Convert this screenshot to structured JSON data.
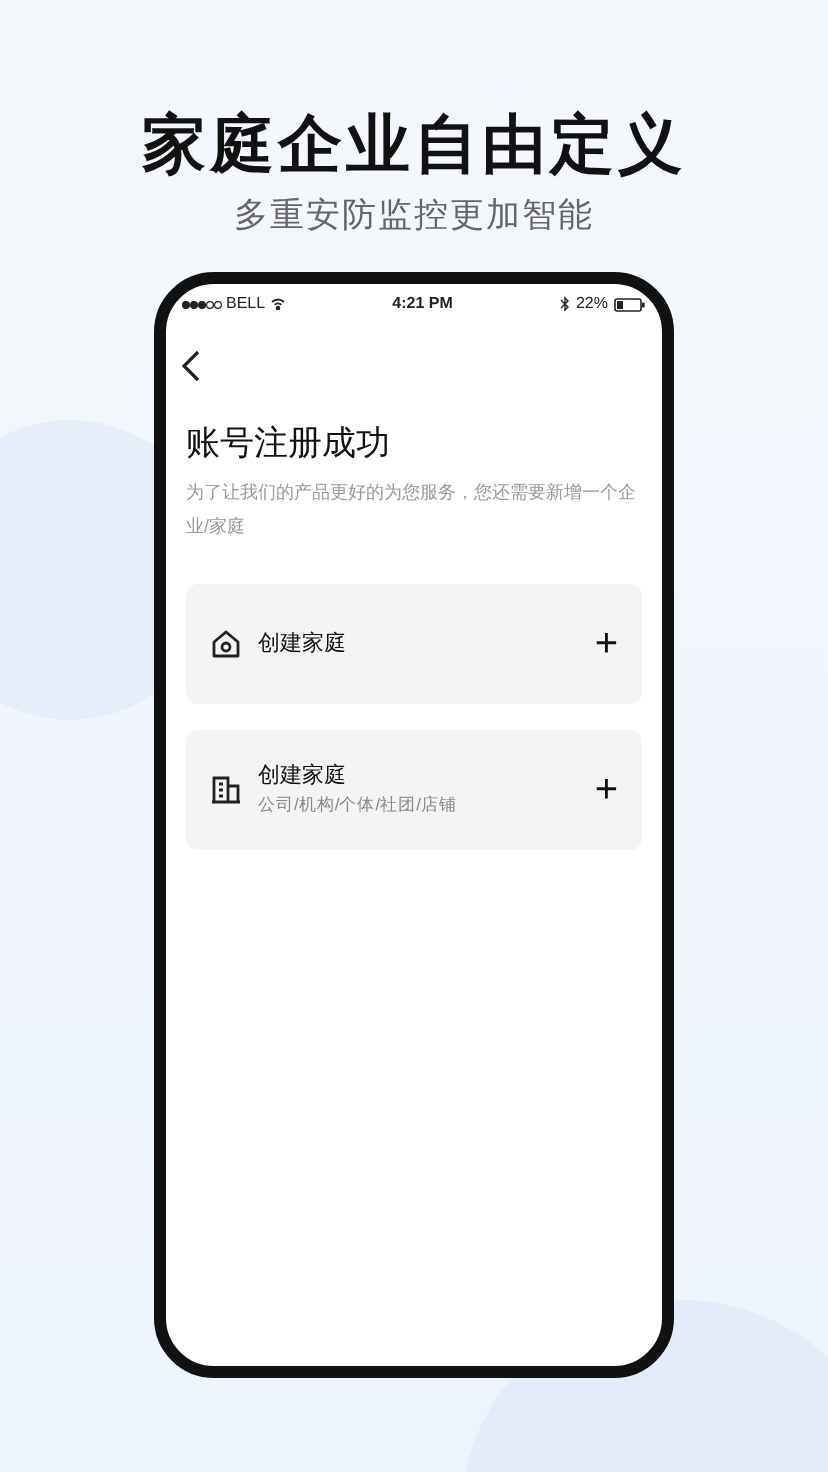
{
  "headline": "家庭企业自由定义",
  "subtitle": "多重安防监控更加智能",
  "status_bar": {
    "carrier": "BELL",
    "time": "4:21 PM",
    "battery": "22%"
  },
  "page": {
    "title": "账号注册成功",
    "description": "为了让我们的产品更好的为您服务，您还需要新增一个企业/家庭"
  },
  "options": [
    {
      "kind": "home",
      "title": "创建家庭",
      "plus": "+"
    },
    {
      "kind": "building",
      "title": "创建家庭",
      "note": "公司/机构/个体/社团/店铺",
      "plus": "+"
    }
  ]
}
